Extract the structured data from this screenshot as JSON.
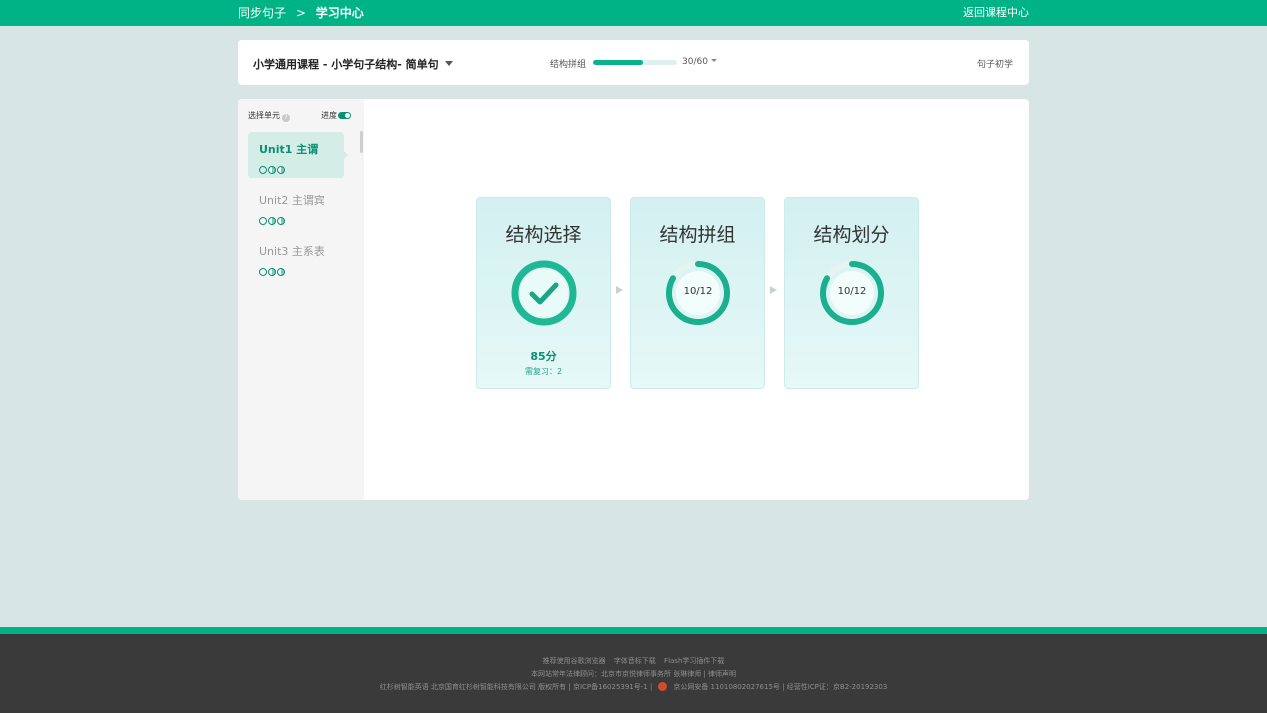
{
  "topbar": {
    "crumb_root": "同步句子",
    "crumb_sep": ">",
    "crumb_current": "学习中心",
    "back_link": "返回课程中心"
  },
  "course": {
    "title": "小学通用课程 - 小学句子结构- 简单句",
    "progress_label": "结构拼组",
    "progress_fraction": 0.6,
    "progress_count": "30/60",
    "level": "句子初学"
  },
  "sidebar": {
    "heading": "选择单元",
    "progress_label": "进度",
    "units": [
      {
        "name": "Unit1 主谓",
        "active": true
      },
      {
        "name": "Unit2 主谓宾",
        "active": false
      },
      {
        "name": "Unit3 主系表",
        "active": false
      }
    ]
  },
  "cards": [
    {
      "title": "结构选择",
      "state": "done",
      "score": "85分",
      "review": "需复习：2"
    },
    {
      "title": "结构拼组",
      "state": "progress",
      "value": "10/12",
      "fraction": 0.8333
    },
    {
      "title": "结构划分",
      "state": "progress",
      "value": "10/12",
      "fraction": 0.8333
    }
  ],
  "footer": {
    "line1": [
      "推荐使用谷歌浏览器",
      "字体音标下载",
      "Flash学习插件下载"
    ],
    "line2": "本网站常年法律顾问：北京市京悦律师事务所 张琳律师 | 律师声明",
    "line3_a": "红杉树智能英语 北京国育红杉树智能科技有限公司 版权所有 | 京ICP备16025391号-1 |",
    "line3_b": "京公网安备 11010802027615号 | 经营性ICP证：京B2-20192303"
  },
  "colors": {
    "brand": "#00b386",
    "accent": "#0a8f72",
    "background": "#d7e5e5",
    "footer": "#3a3a3a"
  }
}
